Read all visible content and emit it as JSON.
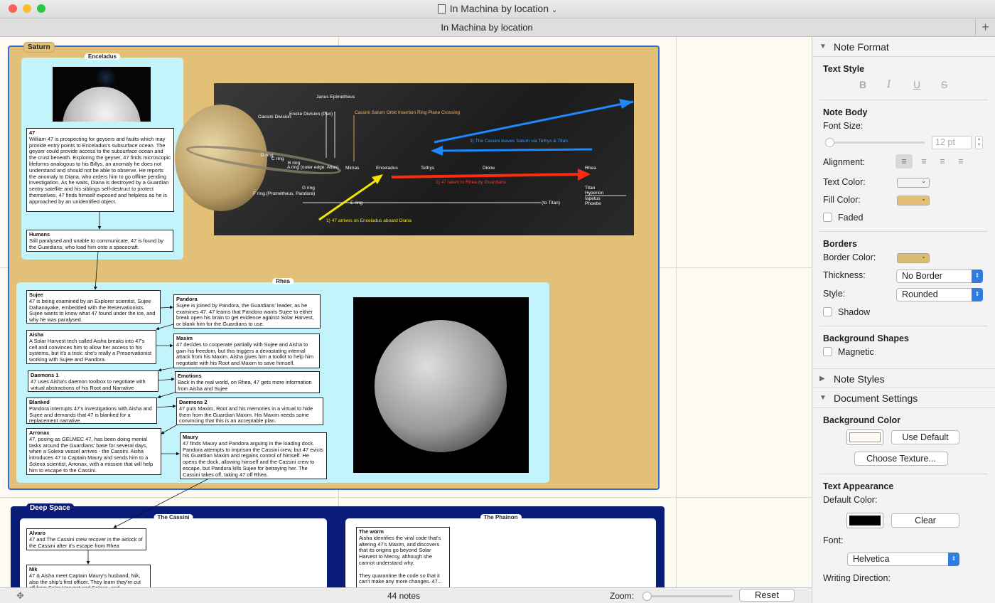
{
  "window": {
    "title": "In Machina by location",
    "tab_title": "In Machina by location",
    "plus": "+"
  },
  "colors": {
    "saturn_bg": "#e3c077",
    "rhea_bg": "#c4f4fb",
    "deep_space_bg": "#0b1b78",
    "selection": "#2f6bd9"
  },
  "canvas": {
    "saturn": {
      "title": "Saturn"
    },
    "enceladus": {
      "title": "Enceladus",
      "notes": [
        {
          "title": "47",
          "body": "William 47 is prospecting for geysers and faults which may provide entry points to Enceladus's subsurface ocean. The geyser could provide access to the subsurface ocean and the crust beneath. Exploring the geyser, 47 finds microscopic lifeforms analogous to his Billys, an anomaly he does not understand and should not be able to observe. He reports the anomaly to Diana, who orders him to go offline pending investigation. As he waits, Diana is destroyed by a Guardian sentry satellite and his siblings self-destruct to protect themselves. 47 finds himself exposed and helpless as he is approached by an unidentified object."
        },
        {
          "title": "Humans",
          "body": "Still paralysed and unable to communicate, 47 is found by the Guardians, who load him onto a spacecraft."
        }
      ]
    },
    "saturn_image": {
      "labels": {
        "cassini_division": "Cassini Division",
        "encke": "Encke Division (Pan)",
        "janus": "Janus Epimetheus",
        "insertion": "Cassini Saturn Orbit Insertion Ring Plane Crossing",
        "d_ring": "D ring",
        "c_ring": "C ring",
        "b_ring": "B ring",
        "a_ring": "A ring (outer edge: Atlas)",
        "f_ring": "F ring (Prometheus, Pandora)",
        "g_ring": "G ring",
        "e_ring": "E ring",
        "to_titan": "(to Titan)",
        "mimas": "Mimas",
        "enceladus": "Enceladus",
        "tethys": "Tethys",
        "dione": "Dione",
        "rhea": "Rhea",
        "titan": "Titan Hyperion Iapetus Phoebe",
        "arrow1": "1) 47 arrives on Enceladus aboard Diana",
        "arrow2": "2) 47 taken to Rhea by Guardians",
        "arrow3": "3) The Cassini leaves Saturn via Tethys & Titan"
      }
    },
    "rhea": {
      "title": "Rhea",
      "left_notes": [
        {
          "title": "Sujee",
          "body": "47 is being examined by an Explorer scientist, Sujee Dahanayake, embedded with the Reservationists. Sujee wants to know what 47 found under the ice, and why he was paralysed."
        },
        {
          "title": "Aisha",
          "body": "A Solar Harvest tech called Aisha breaks into 47's cell and convinces him to allow her access to his systems, but it's a trick: she's really a Preservationist working with Sujee and Pandora."
        },
        {
          "title": "Daemons 1",
          "body": "47 uses Aisha's daemon toolbox to negotiate with virtual abstractions of his Root and Narrative modules."
        },
        {
          "title": "Blanked",
          "body": "Pandora interrupts 47's investigations with Aisha and Sujee and demands that 47 is blanked for a replacement narrative."
        },
        {
          "title": "Arronax",
          "body": "47, posing as GELMEC 47, has been doing menial tasks around the Guardians' base for several days, when a Solexa vessel arrives - the Cassini. Aisha introduces 47 to Captain Maury and sends him to a Solexa scientist, Arronax, with a mission that will help him to escape to the Cassini."
        }
      ],
      "right_notes": [
        {
          "title": "Pandora",
          "body": "Sujee is joined by Pandora, the Guardians' leader, as he examines 47. 47 learns that Pandora wants Sujee to either break open his brain to get evidence against Solar Harvest, or blank him for the Guardians to use."
        },
        {
          "title": "Maxim",
          "body": "47 decides to cooperate partially with Sujee and Aisha to gain his freedom, but this triggers a devastating internal attack from his Maxim. Aisha gives him a toolkit to help him negotiate with his Root and Maxim to save himself."
        },
        {
          "title": "Emotions",
          "body": "Back in the real world, on Rhea, 47 gets more information from Aisha and Sujee"
        },
        {
          "title": "Daemons 2",
          "body": "47 puts Maxim, Root and his memories in a virtual to hide them from the Guardian Maxim. His Maxim needs some convincing that this is an acceptable plan."
        },
        {
          "title": "Maury",
          "body": "47 finds Maury and Pandora arguing in the loading dock. Pandora attempts to imprison the Cassini crew, but 47 evicts his Guardian Maxim and regains control of himself. He opens the dock, allowing himself and the Cassini crew to escape, but Pandora kills Sujee for betraying her. The Cassini takes off, taking 47 off Rhea."
        }
      ]
    },
    "deep_space": {
      "title": "Deep Space",
      "cassini": {
        "title": "The Cassini",
        "notes": [
          {
            "title": "Alvaro",
            "body": "47 and The Cassini crew recover in the airlock of the Cassini after it's escape from Rhea"
          },
          {
            "title": "Nik",
            "body": "47 & Aisha meet Captain Maury's husband, Nik, also the ship's first officer. They learn they're cut off from Solar Harvest and Solexa, and..."
          }
        ]
      },
      "phainon": {
        "title": "The Phainon",
        "notes": [
          {
            "title": "The worm",
            "body": "Aisha identifies the viral code that's altering 47's Maxim, and discovers that its origins go beyond Solar Harvest to Mecsy, although she cannot understand why.\n\nThey quarantine the code so that it can't make any more changes. 47..."
          }
        ]
      }
    }
  },
  "status": {
    "count": "44 notes",
    "zoom_label": "Zoom:",
    "zoom_value": 0.05,
    "reset": "Reset"
  },
  "sidebar": {
    "note_format": "Note Format",
    "text_style": "Text Style",
    "bold": "B",
    "italic": "I",
    "underline": "U",
    "strike": "S",
    "note_body": "Note Body",
    "font_size_label": "Font Size:",
    "font_size_value": "12 pt",
    "alignment_label": "Alignment:",
    "text_color_label": "Text Color:",
    "fill_color_label": "Fill Color:",
    "fill_color": "#e3c077",
    "faded": "Faded",
    "borders": "Borders",
    "border_color_label": "Border Color:",
    "border_color": "#d9bd70",
    "thickness_label": "Thickness:",
    "thickness_value": "No Border",
    "style_label": "Style:",
    "style_value": "Rounded",
    "shadow": "Shadow",
    "background_shapes": "Background Shapes",
    "magnetic": "Magnetic",
    "note_styles": "Note Styles",
    "document_settings": "Document Settings",
    "background_color": "Background Color",
    "use_default": "Use Default",
    "choose_texture": "Choose Texture...",
    "text_appearance": "Text Appearance",
    "default_color_label": "Default Color:",
    "clear": "Clear",
    "font_label": "Font:",
    "font_value": "Helvetica",
    "writing_direction": "Writing Direction:"
  }
}
